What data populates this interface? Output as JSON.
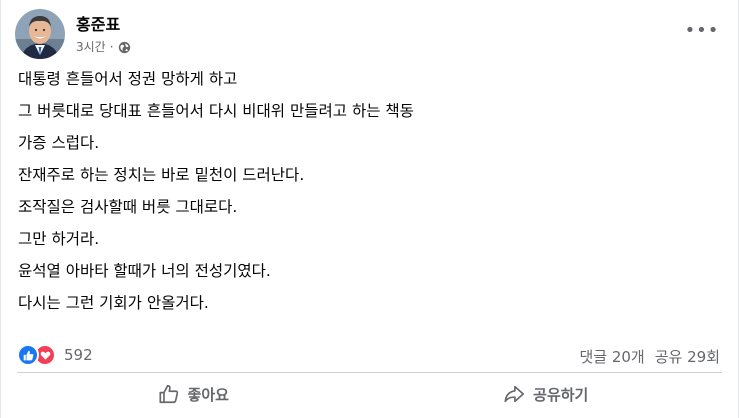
{
  "post": {
    "author": "홍준표",
    "time": "3시간",
    "separator": "·",
    "more_label": "•••",
    "lines": [
      "대통령 흔들어서 정권 망하게 하고",
      "그 버릇대로 당대표 흔들어서 다시 비대위 만들려고 하는 책동",
      "가증 스럽다.",
      "잔재주로 하는 정치는 바로 밑천이 드러난다.",
      "조작질은 검사할때 버릇 그대로다.",
      "그만 하거라.",
      "윤석열 아바타 할때가 너의 전성기였다.",
      "다시는 그런 기회가 안올거다."
    ]
  },
  "engagement": {
    "reaction_count": "592",
    "comments": "댓글 20개",
    "shares": "공유 29회"
  },
  "actions": {
    "like_label": "좋아요",
    "share_label": "공유하기"
  },
  "colors": {
    "like_blue": "#1877f2",
    "love_red": "#f33e58",
    "secondary_text": "#65676b"
  }
}
